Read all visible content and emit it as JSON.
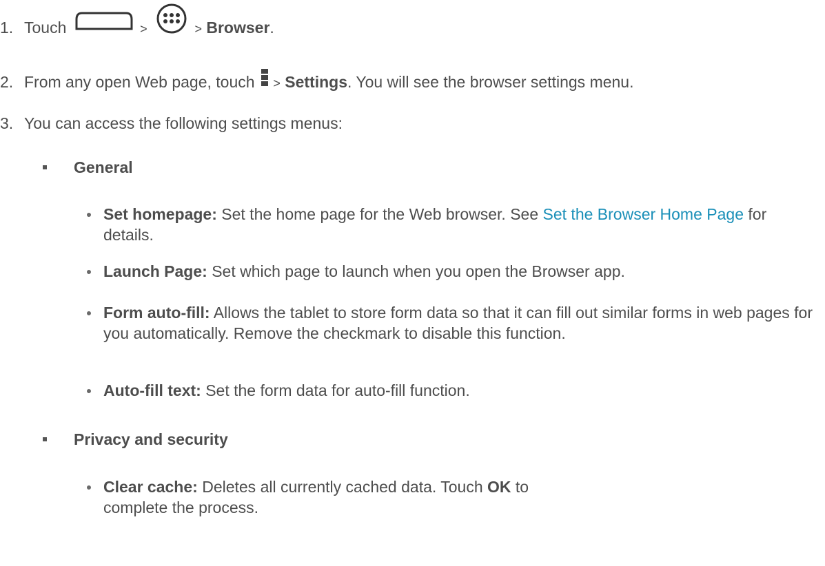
{
  "steps": [
    {
      "number": "1.",
      "prefix": "Touch",
      "sep1": ">",
      "sep2": ">",
      "target": "Browser",
      "end": ".",
      "icons": [
        "home-icon",
        "apps-icon"
      ]
    },
    {
      "number": "2.",
      "prefix": "From any open Web page, touch",
      "sep": ">",
      "target": "Settings",
      "suffix": ". You will see the browser settings menu.",
      "icons": [
        "menu-icon"
      ]
    },
    {
      "number": "3.",
      "text": "You can access the following settings menus:"
    }
  ],
  "sections": [
    {
      "title": "General",
      "items": [
        {
          "term": "Set homepage:",
          "desc": " Set the home page for the Web browser. See ",
          "link": "Set the Browser Home Page",
          "after": " for details."
        },
        {
          "term": "Launch Page:",
          "desc": " Set which page to launch when you open the Browser app."
        },
        {
          "term": "Form auto-fill:",
          "desc": " Allows the tablet to store form data so that it can fill out similar forms in web pages for you automatically. Remove the checkmark to disable this function."
        },
        {
          "term": "Auto-fill text:",
          "desc": " Set the form data for auto-fill function."
        }
      ]
    },
    {
      "title": "Privacy and security",
      "items": [
        {
          "term": "Clear cache:",
          "desc": " Deletes all currently cached data. Touch ",
          "bold2": "OK",
          "after": " to complete the process."
        }
      ]
    }
  ]
}
